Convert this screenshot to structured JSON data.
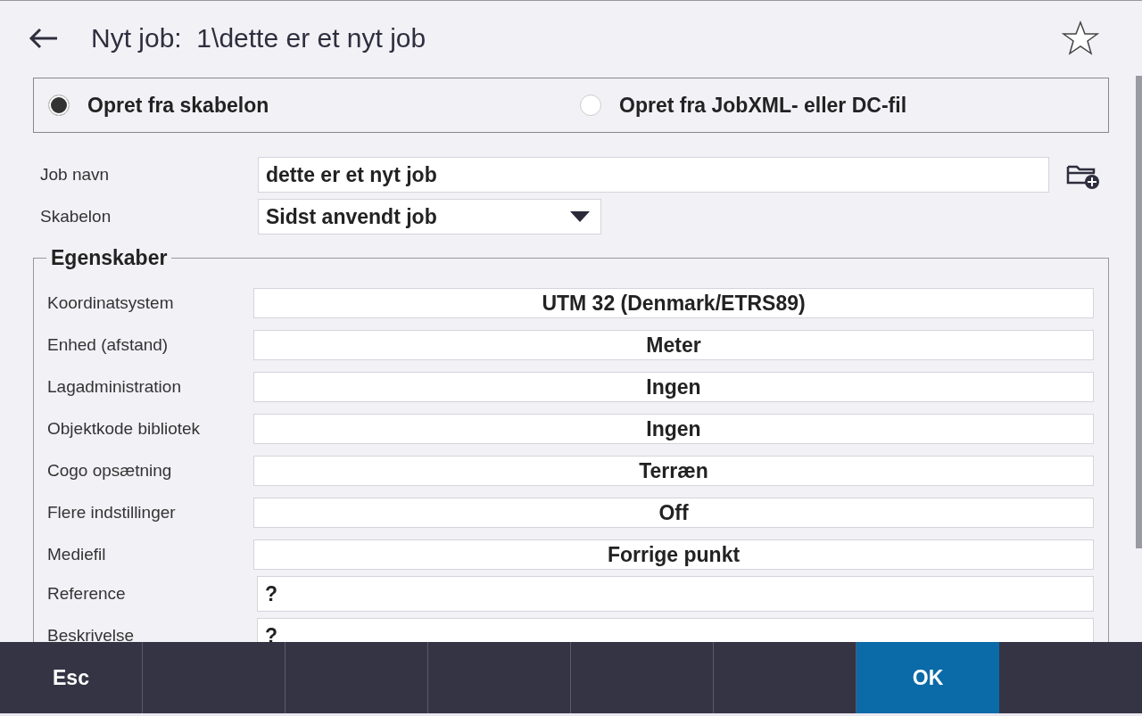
{
  "header": {
    "title": "Nyt job:  1\\dette er et nyt job",
    "favorite": false
  },
  "source_options": [
    {
      "label": "Opret fra skabelon",
      "selected": true
    },
    {
      "label": "Opret fra JobXML- eller DC-fil",
      "selected": false
    }
  ],
  "job_name": {
    "label": "Job navn",
    "value": "dette er et nyt job"
  },
  "template": {
    "label": "Skabelon",
    "value": "Sidst anvendt job"
  },
  "properties": {
    "title": "Egenskaber",
    "rows": [
      {
        "label": "Koordinatsystem",
        "value": "UTM 32 (Denmark/ETRS89)",
        "kind": "button"
      },
      {
        "label": "Enhed (afstand)",
        "value": "Meter",
        "kind": "button"
      },
      {
        "label": "Lagadministration",
        "value": "Ingen",
        "kind": "button"
      },
      {
        "label": "Objektkode bibliotek",
        "value": "Ingen",
        "kind": "button"
      },
      {
        "label": "Cogo opsætning",
        "value": "Terræn",
        "kind": "button"
      },
      {
        "label": "Flere indstillinger",
        "value": "Off",
        "kind": "button"
      },
      {
        "label": "Mediefil",
        "value": "Forrige punkt",
        "kind": "button"
      },
      {
        "label": "Reference",
        "value": "?",
        "kind": "field"
      },
      {
        "label": "Beskrivelse",
        "value": "?",
        "kind": "field"
      }
    ]
  },
  "softkeys": [
    {
      "kind": "key",
      "label": "Esc"
    },
    {
      "kind": "empty"
    },
    {
      "kind": "empty"
    },
    {
      "kind": "empty"
    },
    {
      "kind": "empty"
    },
    {
      "kind": "empty"
    },
    {
      "kind": "primary",
      "label": "OK"
    }
  ]
}
